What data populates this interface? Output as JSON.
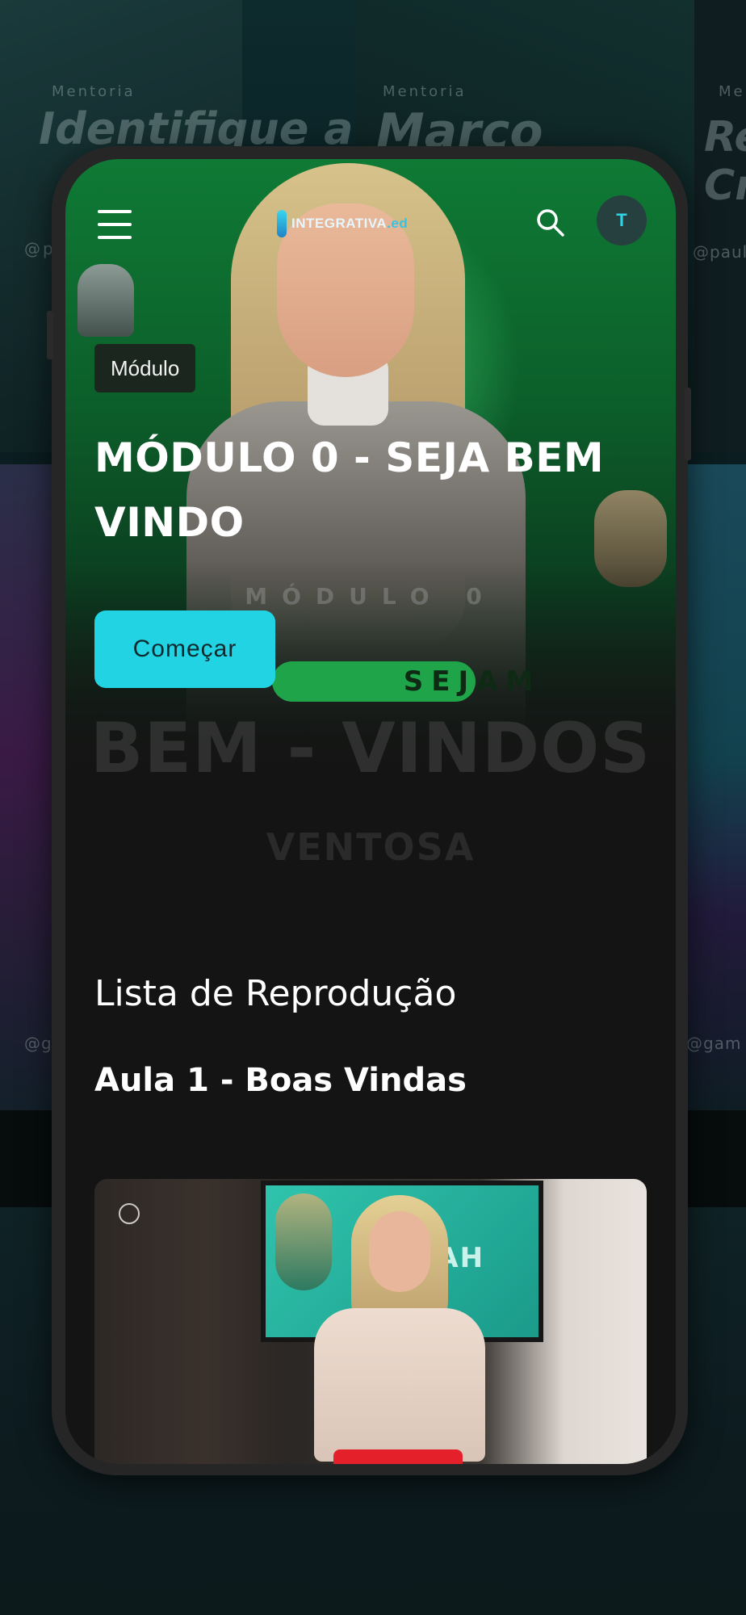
{
  "header": {
    "logo_text": "INTEGRATIVA",
    "logo_suffix": ".ed",
    "avatar_initial": "T"
  },
  "hero": {
    "badge": "Módulo",
    "title": "MÓDULO 0 - SEJA BEM VINDO",
    "start_button": "Começar",
    "poster": {
      "modulo": "MÓDULO 0",
      "sejam": "SEJAM",
      "bem_vindos": "BEM - VINDOS",
      "brand": "VENTOSA"
    }
  },
  "playlist": {
    "title": "Lista de Reprodução",
    "lesson_title": "Aula 1 - Boas Vindas",
    "video_overlay_text": "RAMAH"
  },
  "background": {
    "tiles": [
      {
        "label": "Mentoria",
        "title": "Identifique a"
      },
      {
        "label": "Mentoria",
        "title": "Marco"
      },
      {
        "label": "Mentoria",
        "title": "Re Cr"
      }
    ],
    "handles": [
      "@p",
      "@paul",
      "@g",
      "@gam"
    ]
  },
  "colors": {
    "accent": "#21d3e3",
    "hero_green": "#0f7a35",
    "screen_bg": "#141414",
    "avatar_bg": "#25403f"
  }
}
